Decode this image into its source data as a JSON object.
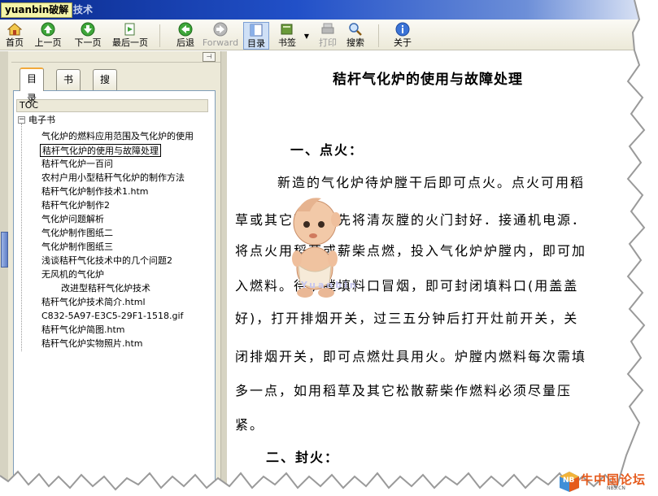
{
  "window": {
    "title_highlight": "yuanbin破解",
    "title_rest": "技术"
  },
  "toolbar": {
    "home": "首页",
    "prev_page": "上一页",
    "next_page": "下一页",
    "last_page": "最后一页",
    "back": "后退",
    "forward": "Forward",
    "toc": "目录",
    "bookmark": "书签",
    "print": "打印",
    "search": "搜索",
    "about": "关于"
  },
  "sidebar": {
    "tabs": [
      "目录",
      "书签",
      "搜索"
    ],
    "active_tab": "目录",
    "toc_header": "TOC",
    "root_toggle": "−",
    "root_label": "电子书",
    "items": [
      {
        "label": "气化炉的燃料应用范围及气化炉的使用",
        "selected": false,
        "indent": false
      },
      {
        "label": "秸杆气化炉的使用与故障处理",
        "selected": true,
        "indent": false
      },
      {
        "label": "秸杆气化炉一百问",
        "selected": false,
        "indent": false
      },
      {
        "label": "农村户用小型秸秆气化炉的制作方法",
        "selected": false,
        "indent": false
      },
      {
        "label": "秸秆气化炉制作技术1.htm",
        "selected": false,
        "indent": false
      },
      {
        "label": "秸秆气化炉制作2",
        "selected": false,
        "indent": false
      },
      {
        "label": "气化炉问题解析",
        "selected": false,
        "indent": false
      },
      {
        "label": "气化炉制作图纸二",
        "selected": false,
        "indent": false
      },
      {
        "label": "气化炉制作图纸三",
        "selected": false,
        "indent": false
      },
      {
        "label": "浅谈秸秆气化技术中的几个问题2",
        "selected": false,
        "indent": false
      },
      {
        "label": "无风机的气化炉",
        "selected": false,
        "indent": false
      },
      {
        "label": "改进型秸秆气化炉技术",
        "selected": false,
        "indent": true
      },
      {
        "label": "秸秆气化炉技术简介.html",
        "selected": false,
        "indent": false
      },
      {
        "label": "C832-5A97-E3C5-29F1-1518.gif",
        "selected": false,
        "indent": false
      },
      {
        "label": "秸秆气化炉简图.htm",
        "selected": false,
        "indent": false
      },
      {
        "label": "秸秆气化炉实物照片.htm",
        "selected": false,
        "indent": false
      }
    ]
  },
  "document": {
    "title": "秸杆气化炉的使用与故障处理",
    "section1_heading": "一、点火：",
    "section1_lines": [
      "新造的气化炉待炉膛干后即可点火。点火可用稻",
      "草或其它薪柴。先将清灰膛的火门封好．接通机电源．",
      "将点火用稻草或薪柴点燃，投入气化炉炉膛内，即可加",
      "入燃料。待炉膛填料口冒烟，即可封闭填料口(用盖盖",
      "好)，打开排烟开关，过三五分钟后打开灶前开关，关",
      "闭排烟开关，即可点燃灶具用火。炉膛内燃料每次需填",
      "多一点，如用稻草及其它松散薪柴作燃料必须尽量压",
      "紧。"
    ],
    "section2_heading": "二、封火："
  },
  "watermark": "Yuanbin",
  "logo": {
    "mark": "NB",
    "text": "牛中国论坛",
    "sub": "NBS.CN"
  },
  "colors": {
    "title_gradient_start": "#0a2a8c",
    "title_highlight_bg": "#f4f4a8",
    "toolbar_bg": "#ece9d8",
    "tree_border": "#7f9db9",
    "active_tab_accent": "#f2a93b",
    "logo_orange": "#e55a1c"
  }
}
